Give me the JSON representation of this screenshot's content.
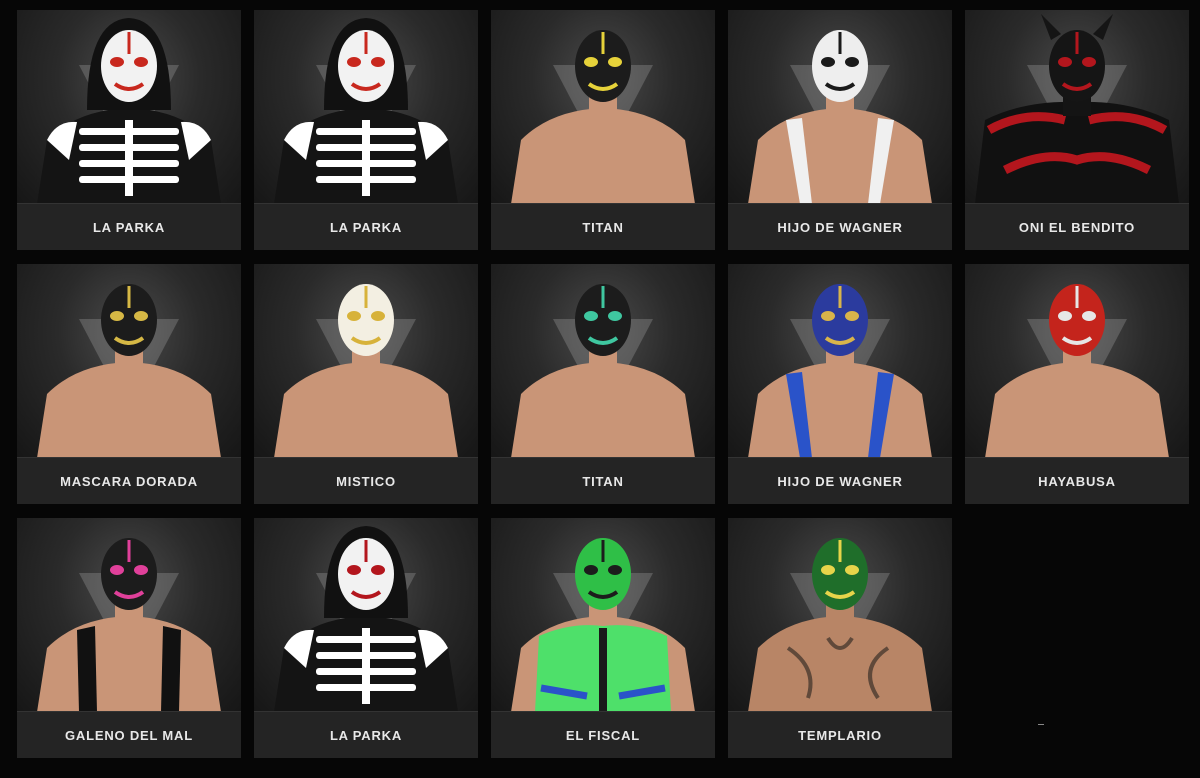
{
  "roster": [
    {
      "name": "LA PARKA",
      "mask": "#f2f2f2",
      "accent": "#c8281e",
      "outfit": "skeleton",
      "skin": "#ffffff"
    },
    {
      "name": "LA PARKA",
      "mask": "#f2f2f2",
      "accent": "#c8281e",
      "outfit": "skeleton",
      "skin": "#ffffff"
    },
    {
      "name": "TITAN",
      "mask": "#1c1c1c",
      "accent": "#e6d23a",
      "outfit": "bare",
      "skin": "#c99577"
    },
    {
      "name": "HIJO DE WAGNER",
      "mask": "#eeeeee",
      "accent": "#1a1a1a",
      "outfit": "straps",
      "skin": "#c99577"
    },
    {
      "name": "ONI EL BENDITO",
      "mask": "#151515",
      "accent": "#b3161d",
      "outfit": "cape",
      "skin": "#1a1a1a"
    },
    {
      "name": "MASCARA DORADA",
      "mask": "#1c1c1c",
      "accent": "#d6b845",
      "outfit": "bare",
      "skin": "#c99577"
    },
    {
      "name": "MISTICO",
      "mask": "#f3efe2",
      "accent": "#d7b23a",
      "outfit": "bare",
      "skin": "#c99577"
    },
    {
      "name": "TITAN",
      "mask": "#1c1c1c",
      "accent": "#3fc7a0",
      "outfit": "bare",
      "skin": "#c99577"
    },
    {
      "name": "HIJO DE WAGNER",
      "mask": "#2b3b9e",
      "accent": "#d8b44a",
      "outfit": "blue-straps",
      "skin": "#c99577"
    },
    {
      "name": "HAYABUSA",
      "mask": "#c4241c",
      "accent": "#e6e6e6",
      "outfit": "bare",
      "skin": "#c99577"
    },
    {
      "name": "GALENO DEL MAL",
      "mask": "#1c1c1c",
      "accent": "#e0409a",
      "outfit": "tank",
      "skin": "#c99577"
    },
    {
      "name": "LA PARKA",
      "mask": "#f2f2f2",
      "accent": "#b3161d",
      "outfit": "skeleton",
      "skin": "#ffffff"
    },
    {
      "name": "EL FISCAL",
      "mask": "#2fbf47",
      "accent": "#1c1c1c",
      "outfit": "green-vest",
      "skin": "#c99577"
    },
    {
      "name": "TEMPLARIO",
      "mask": "#1f6e2a",
      "accent": "#e7d44a",
      "outfit": "tattoo",
      "skin": "#b88566"
    }
  ]
}
